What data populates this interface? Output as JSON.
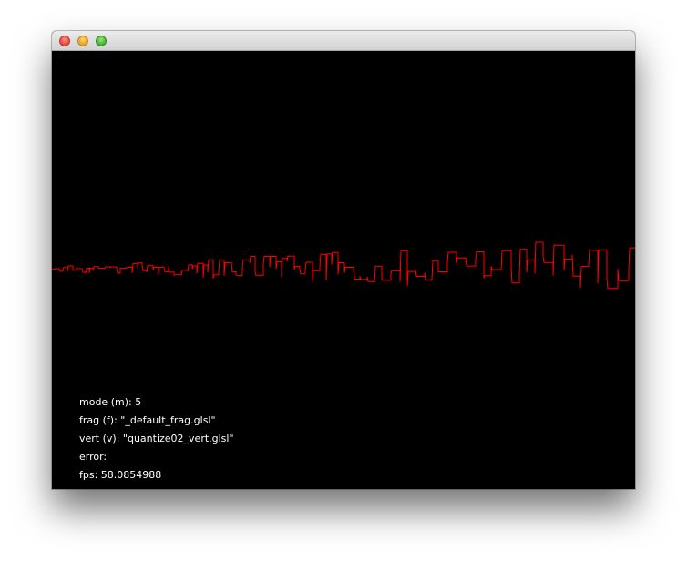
{
  "window": {
    "controls": {
      "close": "close-button",
      "minimize": "minimize-button",
      "zoom": "zoom-button"
    }
  },
  "canvas": {
    "background": "#000000",
    "waveform_color": "#ff0000"
  },
  "hud": {
    "mode": "mode (m): 5",
    "frag": "frag (f): \"_default_frag.glsl\"",
    "vert": "vert (v): \"quantize02_vert.glsl\"",
    "error": "error:",
    "fps": "fps: 58.0854988"
  }
}
